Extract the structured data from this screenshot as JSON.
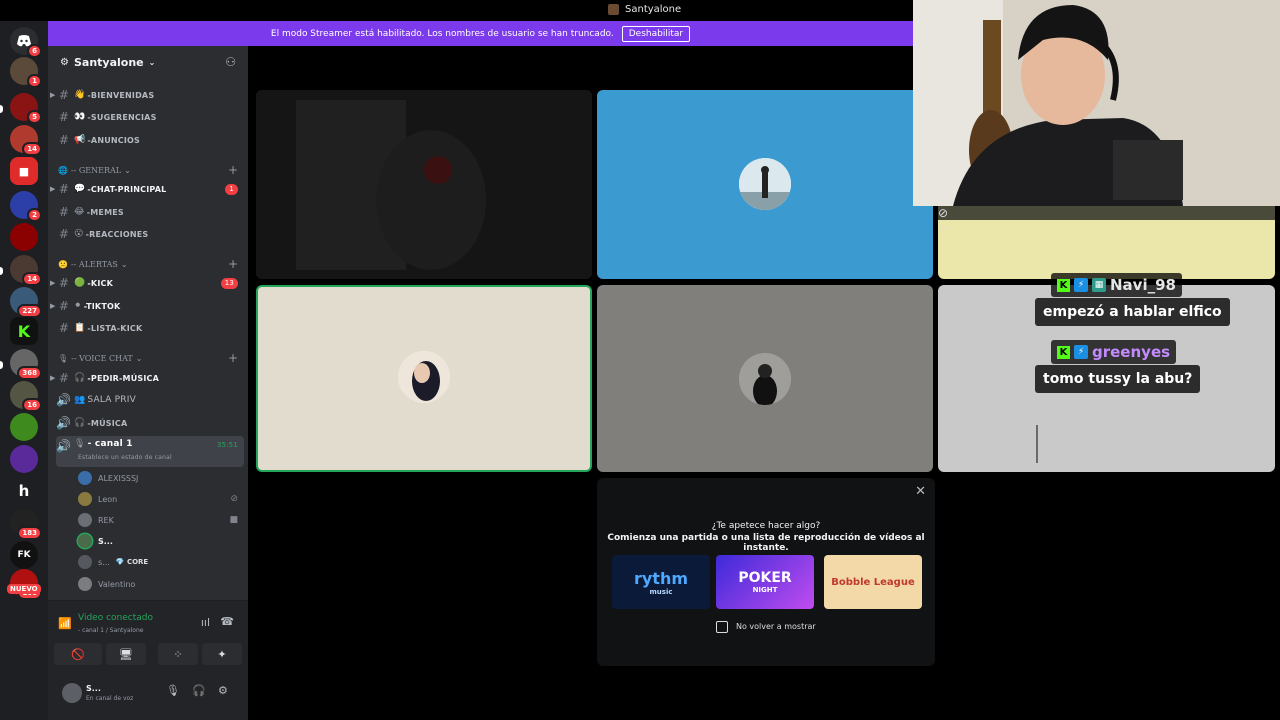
{
  "titlebar": {
    "title": "Santyalone"
  },
  "banner": {
    "text": "El modo Streamer está habilitado. Los nombres de usuario se han truncado.",
    "button_label": "Deshabilitar",
    "color": "#7c3aed"
  },
  "servers": {
    "badges": [
      "6",
      "1",
      "5",
      "14",
      "2",
      "14",
      "227",
      "368",
      "16",
      "183",
      "100"
    ],
    "new_label": "NUEVO"
  },
  "guild": {
    "name": "Santyalone"
  },
  "channels": {
    "top": [
      {
        "name": "-BIENVENIDAS",
        "icon": "waving-hand-icon"
      },
      {
        "name": "-SUGERENCIAS",
        "icon": "eyes-icon"
      },
      {
        "name": "-ANUNCIOS",
        "icon": "megaphone-icon"
      }
    ],
    "categories": [
      {
        "name": "-- GENERAL",
        "channels": [
          {
            "name": "-CHAT-PRINCIPAL",
            "badge": "1"
          },
          {
            "name": "-MEMES"
          },
          {
            "name": "-REACCIONES"
          }
        ]
      },
      {
        "name": "-- ALERTAS",
        "channels": [
          {
            "name": "-KICK",
            "badge": "13"
          },
          {
            "name": "-TIKTOK"
          },
          {
            "name": "-LISTA-KICK"
          }
        ]
      },
      {
        "name": "-- VOICE CHAT",
        "channels": [
          {
            "name": "-PEDIR-MÚSICA"
          },
          {
            "name": "SALA PRIV"
          },
          {
            "name": "-MÚSICA"
          }
        ]
      }
    ],
    "active": {
      "name": "- canal 1",
      "timer": "35:51",
      "status_placeholder": "Establece un estado de canal"
    },
    "members": [
      {
        "name": "ALEXISSSJ",
        "icon": ""
      },
      {
        "name": "Leon",
        "icon": "mic-muted-icon"
      },
      {
        "name": "REK",
        "icon": "camera-icon"
      },
      {
        "name": "S...",
        "icon": ""
      },
      {
        "name": "s...",
        "tag": "CORE",
        "icon": ""
      },
      {
        "name": "Valentino",
        "icon": ""
      }
    ]
  },
  "voice": {
    "title": "Video conectado",
    "subtitle": "- canal 1 / Santyalone"
  },
  "user": {
    "name": "S...",
    "status": "En canal de voz"
  },
  "activity": {
    "heading": "¿Te apetece hacer algo?",
    "subheading": "Comienza una partida o una lista de reproducción de vídeos al instante.",
    "cards": [
      {
        "label": "rythm",
        "sub": "music"
      },
      {
        "label": "POKER",
        "sub": "NIGHT"
      },
      {
        "label": "Bobble League",
        "sub": ""
      }
    ],
    "checkbox_label": "No volver a mostrar"
  },
  "chat_overlay": [
    {
      "user": "Navi_98",
      "message": "empezó a hablar elfico"
    },
    {
      "user": "greenyes",
      "message": "tomo tussy la abu?"
    }
  ],
  "colors": {
    "rail": "#1e1f22",
    "sidebar": "#2b2d31",
    "green": "#23a55a",
    "badge_red": "#f23f43",
    "kick_green": "#53fc18"
  }
}
